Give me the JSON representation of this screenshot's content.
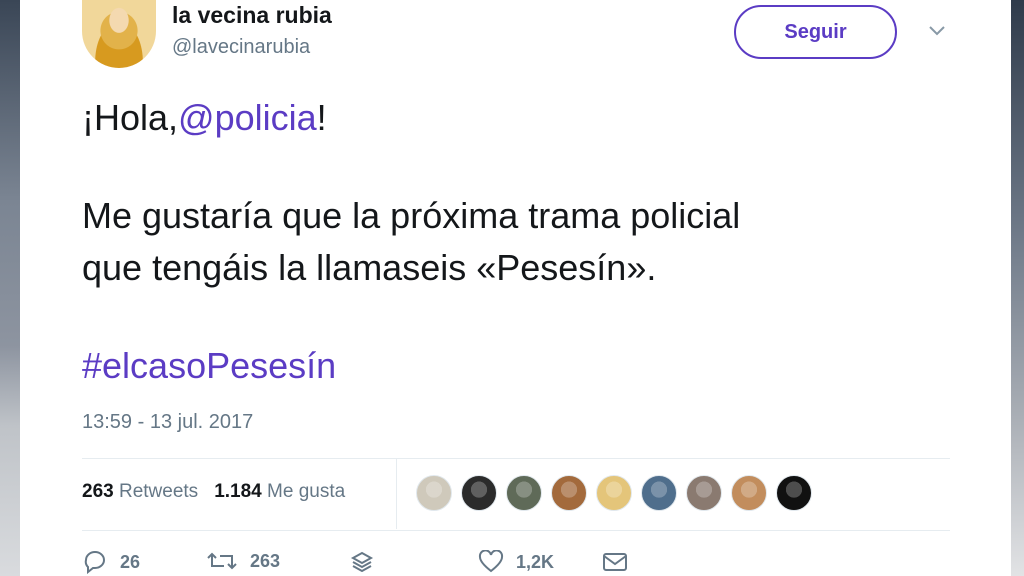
{
  "tweet": {
    "author_name": "la vecina rubia",
    "author_handle": "@lavecinarubia",
    "follow_label": "Seguir",
    "text": {
      "greeting_prefix": "¡Hola,",
      "mention": "@policia",
      "greeting_suffix": "!",
      "line_1": "Me gustaría que la próxima trama policial",
      "line_2": "que tengáis la llamaseis «Pesesín».",
      "hashtag": "#elcasoPesesín"
    },
    "timestamp": "13:59 - 13 jul. 2017",
    "retweets_count": "263",
    "retweets_label": "Retweets",
    "likes_count": "1.184",
    "likes_label": "Me gusta",
    "liker_avatar_colors": [
      "#cfc9bb",
      "#2b2b2b",
      "#5f6a58",
      "#a36a3c",
      "#e4c57a",
      "#4f6e8c",
      "#8a7a70",
      "#c28d5d",
      "#111111"
    ],
    "actions": {
      "reply_count": "26",
      "retweet_count": "263",
      "like_count": "1,2K"
    }
  },
  "colors": {
    "accent": "#5b3cc4",
    "text": "#14171a",
    "muted": "#657786"
  }
}
